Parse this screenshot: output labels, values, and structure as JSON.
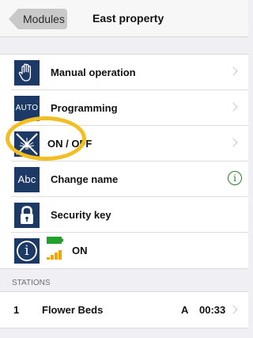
{
  "navbar": {
    "back_label": "Modules",
    "title": "East property"
  },
  "menu": {
    "items": [
      {
        "label": "Manual operation",
        "icon": "hand-icon",
        "accessory": "chevron"
      },
      {
        "label": "Programming",
        "icon_text": "AUTO",
        "accessory": "chevron"
      },
      {
        "label": "ON / OFF",
        "icon": "sprinkler-off-icon",
        "accessory": "chevron"
      },
      {
        "label": "Change name",
        "icon_text": "Abc",
        "accessory": "info",
        "info_glyph": "i"
      },
      {
        "label": "Security key",
        "icon": "padlock-icon",
        "accessory": "none"
      },
      {
        "label": "ON",
        "icon": "info-icon",
        "info_glyph": "i",
        "accessory": "none"
      }
    ]
  },
  "stations": {
    "header": "STATIONS",
    "rows": [
      {
        "number": "1",
        "name": "Flower Beds",
        "program": "A",
        "duration": "00:33"
      }
    ]
  },
  "colors": {
    "icon_background": "#1d3a66",
    "highlight": "#f3be22",
    "battery_green": "#1fa12a",
    "signal_orange": "#f2a400",
    "info_green": "#2a7d2a"
  }
}
